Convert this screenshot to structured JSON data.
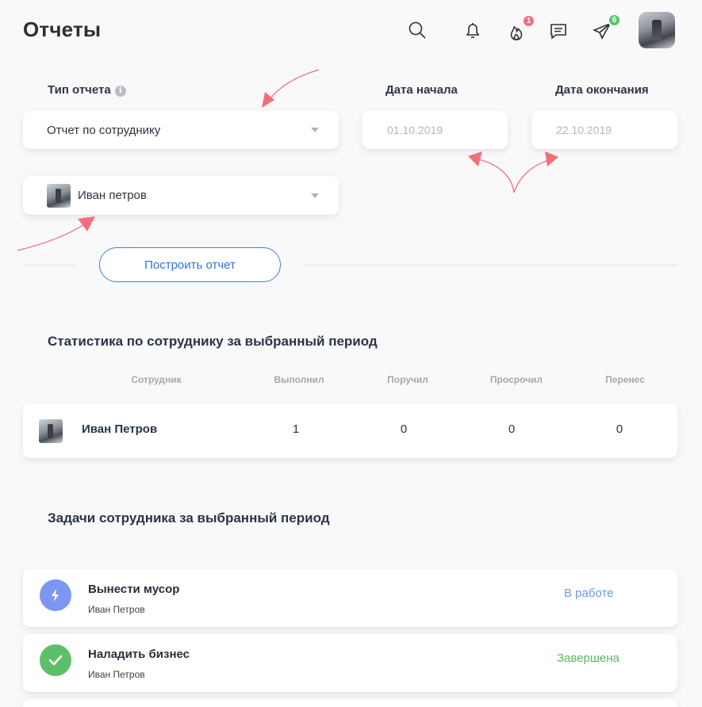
{
  "header": {
    "title": "Отчеты",
    "fire_badge": "1",
    "send_badge": "6",
    "fire_badge_color": "#f26d7d",
    "send_badge_color": "#5ac36a"
  },
  "form": {
    "report_type_label": "Тип отчета",
    "report_type_value": "Отчет по сотруднику",
    "start_date_label": "Дата начала",
    "start_date_placeholder": "01.10.2019",
    "end_date_label": "Дата окончания",
    "end_date_placeholder": "22.10.2019",
    "employee_value": "Иван петров",
    "build_button": "Построить отчет"
  },
  "stats": {
    "title": "Статистика по сотруднику за выбранный период",
    "columns": [
      "Сотрудник",
      "Выполнил",
      "Поручил",
      "Просрочил",
      "Перенес"
    ],
    "row": {
      "name": "Иван Петров",
      "completed": "1",
      "assigned": "0",
      "overdue": "0",
      "postponed": "0"
    }
  },
  "tasks": {
    "title": "Задачи сотрудника за выбранный период",
    "items": [
      {
        "title": "Вынести мусор",
        "assignee": "Иван Петров",
        "status": "В работе",
        "status_color": "#6f98e8",
        "icon": "lightning-icon",
        "icon_color": "#7b97f2"
      },
      {
        "title": "Наладить бизнес",
        "assignee": "Иван Петров",
        "status": "Завершена",
        "status_color": "#5cb85c",
        "icon": "check-icon",
        "icon_color": "#5cbf6a"
      }
    ]
  },
  "annotation_color": "#f0707a"
}
